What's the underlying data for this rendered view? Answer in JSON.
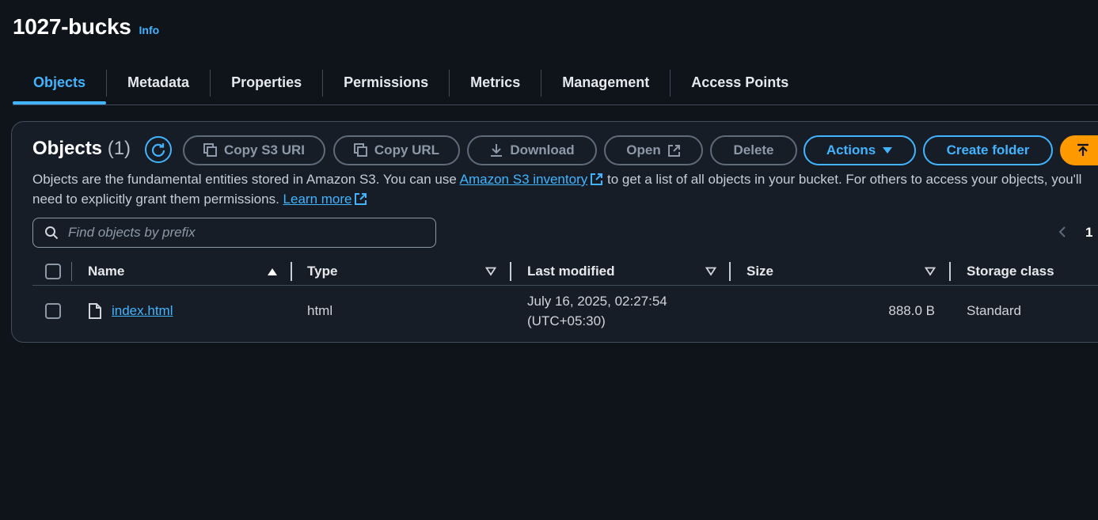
{
  "header": {
    "title": "1027-bucks",
    "info_label": "Info"
  },
  "tabs": [
    {
      "label": "Objects",
      "active": true
    },
    {
      "label": "Metadata"
    },
    {
      "label": "Properties"
    },
    {
      "label": "Permissions"
    },
    {
      "label": "Metrics"
    },
    {
      "label": "Management"
    },
    {
      "label": "Access Points"
    }
  ],
  "objects": {
    "heading": "Objects",
    "count": "(1)",
    "toolbar": {
      "copy_s3_uri": "Copy S3 URI",
      "copy_url": "Copy URL",
      "download": "Download",
      "open": "Open",
      "delete": "Delete",
      "actions": "Actions",
      "create_folder": "Create folder"
    },
    "description": {
      "part1": "Objects are the fundamental entities stored in Amazon S3. You can use",
      "inventory_link": "Amazon S3 inventory",
      "part2": "to get a list of all objects in your bucket. For others to access your objects, you'll",
      "part3": "need to explicitly grant them permissions.",
      "learn_more": "Learn more"
    },
    "search": {
      "placeholder": "Find objects by prefix",
      "value": ""
    },
    "pagination": {
      "current_page": "1"
    },
    "columns": [
      "Name",
      "Type",
      "Last modified",
      "Size",
      "Storage class"
    ],
    "rows": [
      {
        "name": "index.html",
        "type": "html",
        "last_modified_line1": "July 16, 2025, 02:27:54",
        "last_modified_line2": "(UTC+05:30)",
        "size": "888.0 B",
        "storage_class": "Standard"
      }
    ]
  },
  "colors": {
    "accent": "#42b4ff",
    "upload": "#ff9900",
    "background": "#0f141a"
  }
}
